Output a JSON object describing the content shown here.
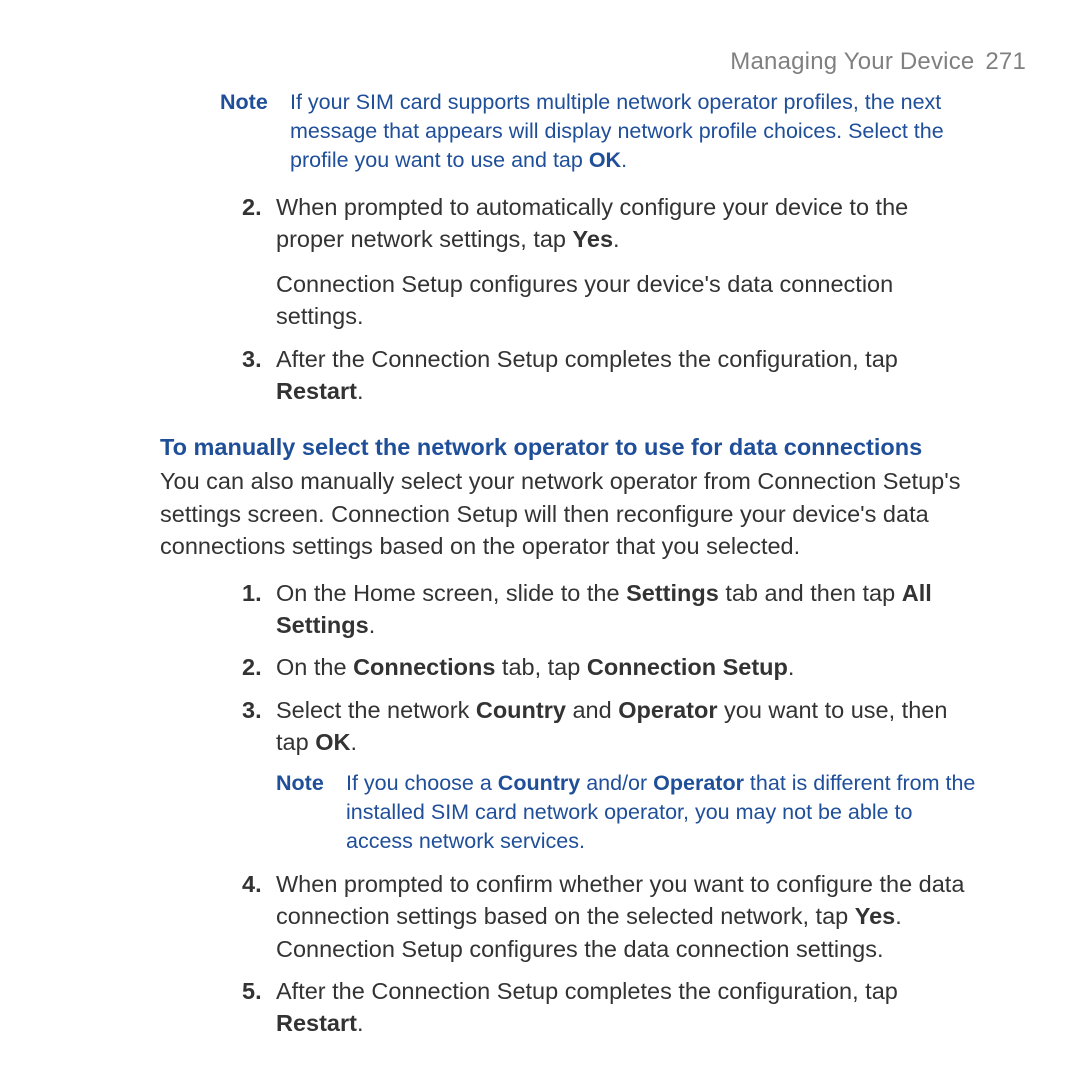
{
  "header": {
    "title": "Managing Your Device",
    "page_number": "271"
  },
  "note1": {
    "label": "Note",
    "text_pre": "If your SIM card supports multiple network operator profiles, the next message that appears will display network profile choices. Select the profile you want to use and tap ",
    "ok": "OK",
    "text_post": "."
  },
  "list1": {
    "item2_pre": "When prompted to automatically configure your device to the proper network settings, tap ",
    "item2_yes": "Yes",
    "item2_post": ".",
    "item2_follow": "Connection Setup configures your device's data connection settings.",
    "item3_pre": "After the Connection Setup completes the configuration, tap ",
    "item3_restart": "Restart",
    "item3_post": "."
  },
  "section": {
    "heading": "To manually select the network operator to use for data connections",
    "para": "You can also manually select your network operator from Connection Setup's settings screen. Connection Setup will then reconfigure your device's data connections settings based on the operator that you selected."
  },
  "list2": {
    "s1_pre": "On the Home screen, slide to the ",
    "s1_b1": "Settings",
    "s1_mid": " tab and then tap ",
    "s1_b2": "All Settings",
    "s1_post": ".",
    "s2_pre": "On the ",
    "s2_b1": "Connections",
    "s2_mid": " tab, tap ",
    "s2_b2": "Connection Setup",
    "s2_post": ".",
    "s3_pre": "Select the network ",
    "s3_b1": "Country",
    "s3_mid": " and ",
    "s3_b2": "Operator",
    "s3_mid2": " you want to use, then tap ",
    "s3_b3": "OK",
    "s3_post": ".",
    "s4_pre": "When prompted to confirm whether you want to configure the data connection settings based on the selected network, tap ",
    "s4_b1": "Yes",
    "s4_post": ".",
    "s4_follow": "Connection Setup configures the data connection settings.",
    "s5_pre": "After the Connection Setup completes the configuration, tap ",
    "s5_b1": "Restart",
    "s5_post": "."
  },
  "note2": {
    "label": "Note",
    "t1": "If you choose a ",
    "b1": "Country",
    "t2": " and/or ",
    "b2": "Operator",
    "t3": " that is different from the installed SIM card network operator, you may not be able to access network services."
  }
}
